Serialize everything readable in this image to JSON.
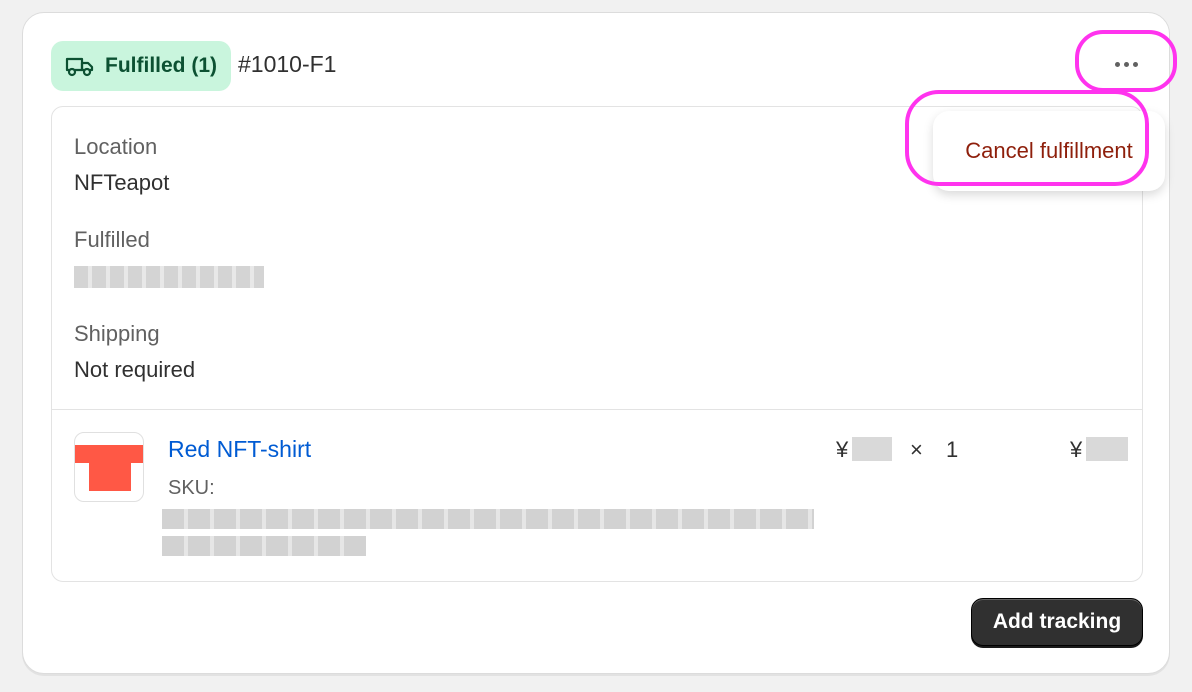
{
  "header": {
    "status_badge": "Fulfilled (1)",
    "status_icon": "truck-icon",
    "order_id": "#1010-F1",
    "more_icon": "more-horizontal-icon"
  },
  "menu": {
    "cancel_label": "Cancel fulfillment"
  },
  "details": {
    "location_label": "Location",
    "location_value": "NFTeapot",
    "fulfilled_label": "Fulfilled",
    "shipping_label": "Shipping",
    "shipping_value": "Not required"
  },
  "line_item": {
    "name": "Red NFT-shirt",
    "sku_label": "SKU:",
    "currency": "¥",
    "times": "×",
    "quantity": "1"
  },
  "footer": {
    "add_tracking_label": "Add tracking"
  },
  "colors": {
    "badge_bg": "#c9f5dd",
    "badge_text": "#0c5132",
    "link": "#005bd3",
    "critical": "#8e1f0b",
    "highlight": "#ff33ee",
    "shirt": "#ff5845"
  }
}
